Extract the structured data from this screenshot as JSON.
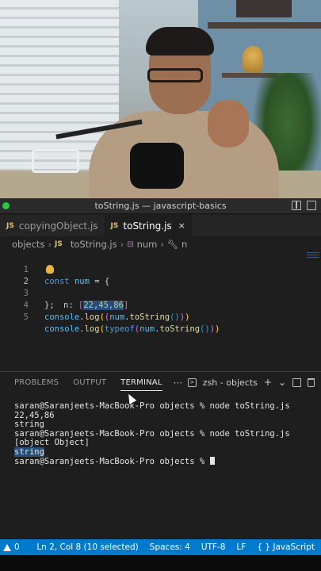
{
  "window": {
    "title": "toString.js — javascript-basics"
  },
  "tabs": [
    {
      "icon": "JS",
      "label": "copyingObject.js"
    },
    {
      "icon": "JS",
      "label": "toString.js",
      "close": "×"
    }
  ],
  "breadcrumb": {
    "folder": "objects",
    "file_icon": "JS",
    "file": "toString.js",
    "symbol1": "num",
    "symbol2": "n"
  },
  "editor": {
    "line_numbers": [
      "1",
      "2",
      "3",
      "4",
      "5"
    ],
    "lines": {
      "l1": {
        "kw": "const",
        "var": "num",
        "rest": " = {"
      },
      "l2": {
        "prop": "n",
        "colon": ": ",
        "open": "[",
        "value": "22,45,86",
        "close": "]"
      },
      "l3": {
        "text": "};"
      },
      "l4": {
        "obj": "console",
        "fn": "log",
        "inner_var": "num",
        "inner_fn": "toString"
      },
      "l5": {
        "obj": "console",
        "fn": "log",
        "kw": "typeof",
        "inner_var": "num",
        "inner_fn": "toString"
      }
    }
  },
  "panel": {
    "tabs": [
      "PROBLEMS",
      "OUTPUT",
      "TERMINAL"
    ],
    "more": "···",
    "shell": "zsh - objects",
    "add": "+",
    "dropdown": "⌄"
  },
  "terminal": {
    "lines": [
      "saran@Saranjeets-MacBook-Pro objects % node toString.js",
      "22,45,86",
      "string",
      "saran@Saranjeets-MacBook-Pro objects % node toString.js",
      "[object Object]",
      "string",
      "saran@Saranjeets-MacBook-Pro objects % "
    ]
  },
  "statusbar": {
    "problems": "0",
    "position": "Ln 2, Col 8 (10 selected)",
    "spaces": "Spaces: 4",
    "encoding": "UTF-8",
    "eol": "LF",
    "language_icon": "{ }",
    "language": "JavaScript"
  },
  "colors": {
    "accent": "#007acc",
    "background": "#1e1e1e",
    "selection": "#264f78"
  }
}
